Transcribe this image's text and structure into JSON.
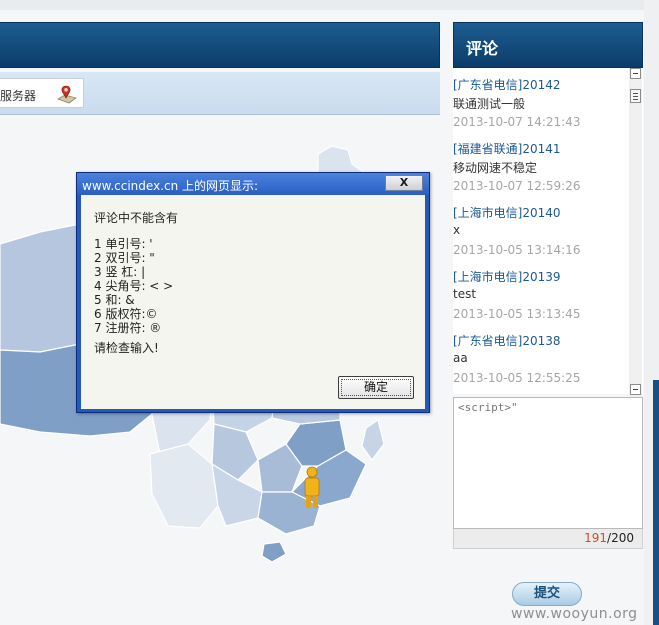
{
  "header": {
    "left_title": ""
  },
  "sub_bar": {
    "server_label": "服务器",
    "server_icon": "map-pin-icon"
  },
  "dialog": {
    "title": "www.ccindex.cn 上的网页显示:",
    "close_label": "X",
    "message_head": "评论中不能含有",
    "rules": [
      "1 单引号: '",
      "2 双引号: \"",
      "3 竖 杠: |",
      "4 尖角号: < >",
      "5 和: &",
      "6 版权符:©",
      "7 注册符: ®"
    ],
    "message_foot": "请检查输入!",
    "ok_label": "确定"
  },
  "comments": {
    "title": "评论",
    "items": [
      {
        "who": "[广东省电信]20142",
        "text": "联通测试一般",
        "time": "2013-10-07 14:21:43"
      },
      {
        "who": "[福建省联通]20141",
        "text": "移动网速不稳定",
        "time": "2013-10-07 12:59:26"
      },
      {
        "who": "[上海市电信]20140",
        "text": "x",
        "time": "2013-10-05 13:14:16"
      },
      {
        "who": "[上海市电信]20139",
        "text": "test",
        "time": "2013-10-05 13:13:45"
      },
      {
        "who": "[广东省电信]20138",
        "text": "aa",
        "time": "2013-10-05 12:55:25"
      }
    ]
  },
  "input": {
    "value": "<script>\""
  },
  "counter": {
    "used": "191",
    "max": "/200"
  },
  "submit_label": "提交",
  "watermark": "www.wooyun.org",
  "colors": {
    "header_blue": "#0a3c6a",
    "map_dark": "#7f9fc6",
    "map_light": "#dbe3ee",
    "counter_used": "#d24d2b"
  }
}
